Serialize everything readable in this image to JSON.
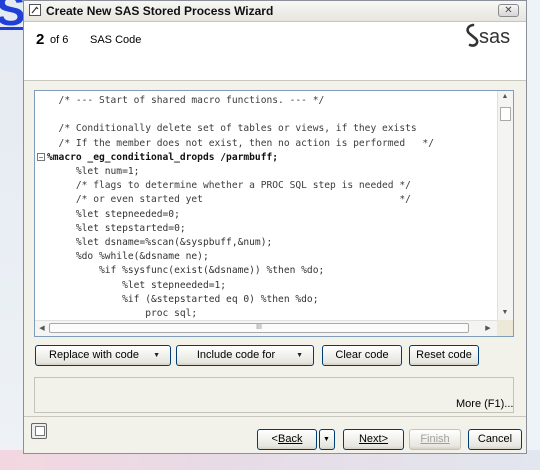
{
  "background": {
    "brand_fragment": "SAS"
  },
  "window": {
    "title": "Create New SAS Stored Process Wizard",
    "close_symbol": "✕"
  },
  "header": {
    "step_number": "2",
    "step_of": "of 6",
    "step_title": "SAS Code",
    "logo_text": "sas"
  },
  "editor": {
    "lines": [
      {
        "text": "  /* --- Start of shared macro functions. --- */",
        "kind": "comment",
        "fold": ""
      },
      {
        "text": "",
        "kind": "code",
        "fold": ""
      },
      {
        "text": "  /* Conditionally delete set of tables or views, if they exists",
        "kind": "comment",
        "fold": ""
      },
      {
        "text": "  /* If the member does not exist, then no action is performed   */",
        "kind": "comment",
        "fold": ""
      },
      {
        "text": "%macro _eg_conditional_dropds /parmbuff;",
        "kind": "macro",
        "fold": "−"
      },
      {
        "text": "     %let num=1;",
        "kind": "code",
        "fold": ""
      },
      {
        "text": "     /* flags to determine whether a PROC SQL step is needed */",
        "kind": "comment",
        "fold": ""
      },
      {
        "text": "     /* or even started yet                                  */",
        "kind": "comment",
        "fold": ""
      },
      {
        "text": "     %let stepneeded=0;",
        "kind": "code",
        "fold": ""
      },
      {
        "text": "     %let stepstarted=0;",
        "kind": "code",
        "fold": ""
      },
      {
        "text": "     %let dsname=%scan(&syspbuff,&num);",
        "kind": "code",
        "fold": ""
      },
      {
        "text": "     %do %while(&dsname ne);",
        "kind": "code",
        "fold": ""
      },
      {
        "text": "         %if %sysfunc(exist(&dsname)) %then %do;",
        "kind": "code",
        "fold": ""
      },
      {
        "text": "             %let stepneeded=1;",
        "kind": "code",
        "fold": ""
      },
      {
        "text": "             %if (&stepstarted eq 0) %then %do;",
        "kind": "code",
        "fold": ""
      },
      {
        "text": "                 proc sql;",
        "kind": "code",
        "fold": ""
      }
    ],
    "scroll_thumb_glyph": "III"
  },
  "buttons": {
    "replace_with_code": "Replace with code",
    "include_code_for": "Include code for",
    "clear_code": "Clear code",
    "reset_code": "Reset code"
  },
  "more_link": "More (F1)...",
  "footer": {
    "back": "Back",
    "next": "Next>",
    "finish": "Finish",
    "cancel": "Cancel"
  },
  "colors": {
    "titlebar": "#e6e5df",
    "dialog_bg": "#f2f1ea",
    "button_border": "#003c74",
    "editor_border": "#7f9db9"
  }
}
